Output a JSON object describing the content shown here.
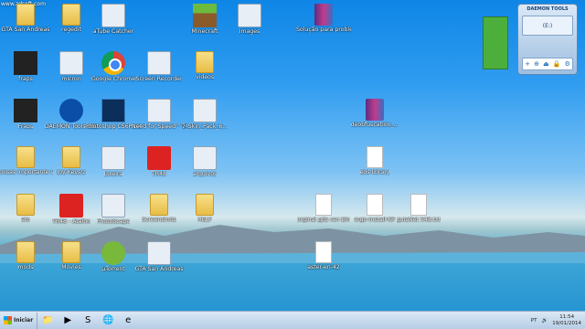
{
  "watermark": "www.zdsoft.com",
  "icons": [
    {
      "label": "GTA San Andreas",
      "type": "folder"
    },
    {
      "label": "regedit",
      "type": "folder"
    },
    {
      "label": "aTube Catcher",
      "type": "exe"
    },
    {
      "label": "Minecraft",
      "type": "mc"
    },
    {
      "label": "images",
      "type": "exe"
    },
    {
      "label": "Solução para problema de fml",
      "type": "rar"
    },
    {
      "label": "fraps",
      "type": "fraps"
    },
    {
      "label": "micron",
      "type": "exe"
    },
    {
      "label": "Google Chrome",
      "type": "chrome"
    },
    {
      "label": "Screen Recorder",
      "type": "exe"
    },
    {
      "label": "videos",
      "type": "folder"
    },
    {
      "label": "Fraps",
      "type": "fraps"
    },
    {
      "label": "DAEMON Tools Lite",
      "type": "daemon"
    },
    {
      "label": "Photoshop CS6P... Atalho",
      "type": "psd"
    },
    {
      "label": "Need for Speed™ Mo...",
      "type": "exe"
    },
    {
      "label": "7_Skin_Pack_6...",
      "type": "exe"
    },
    {
      "label": "deobfuscation_...",
      "type": "rar"
    },
    {
      "label": "coisas importante vida...",
      "type": "folder"
    },
    {
      "label": "Joy-Keys/z",
      "type": "folder"
    },
    {
      "label": "Lixeira",
      "type": "exe"
    },
    {
      "label": "TR48",
      "type": "red"
    },
    {
      "label": "arquivos",
      "type": "exe"
    },
    {
      "label": "eds library",
      "type": "doc"
    },
    {
      "label": "eto",
      "type": "folder"
    },
    {
      "label": "TR48 - Atalho",
      "type": "red"
    },
    {
      "label": "PhotoScape",
      "type": "exe"
    },
    {
      "label": "Screenshots",
      "type": "folder"
    },
    {
      "label": "HELP",
      "type": "folder"
    },
    {
      "label": "orginal gds ran Bin",
      "type": "doc"
    },
    {
      "label": "ergo-install-NF",
      "type": "doc"
    },
    {
      "label": "guiaNet 548.txt",
      "type": "doc"
    },
    {
      "label": "mods",
      "type": "folder"
    },
    {
      "label": "Movies",
      "type": "folder"
    },
    {
      "label": "µTorrent",
      "type": "torrent"
    },
    {
      "label": "GTA San Andreas",
      "type": "exe"
    },
    {
      "label": "aster-en-42",
      "type": "doc"
    }
  ],
  "gadget": {
    "title": "DAEMON TOOLS",
    "drive": "(E:)",
    "actions": [
      "+",
      "⊕",
      "⏏",
      "🔒",
      "⚙"
    ]
  },
  "taskbar": {
    "start_label": "Iniciar",
    "apps": [
      "📁",
      "▶",
      "S",
      "🌐",
      "e"
    ],
    "lang": "PT",
    "time": "11:54",
    "date": "19/01/2014"
  }
}
